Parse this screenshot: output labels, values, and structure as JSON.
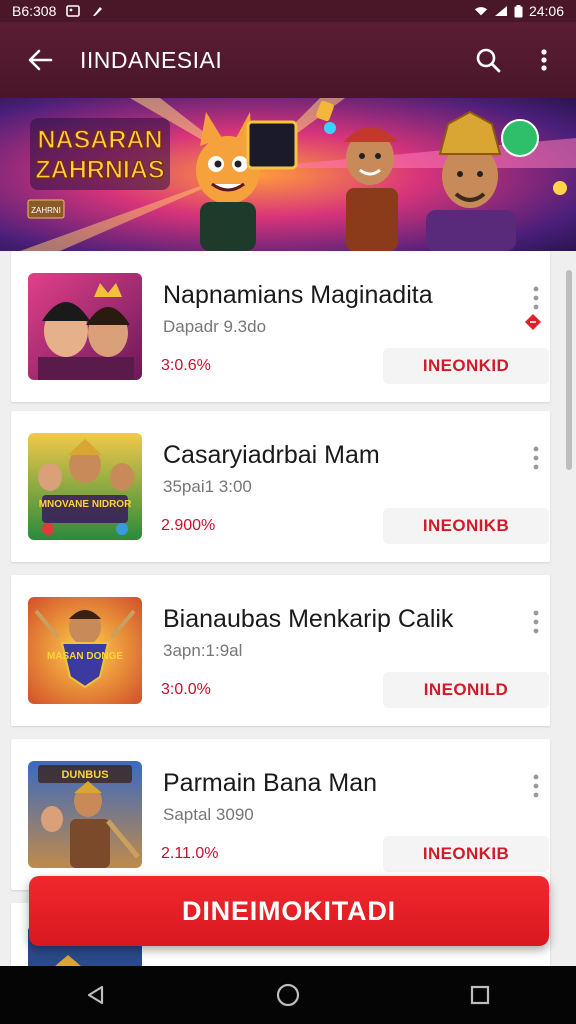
{
  "status_bar": {
    "left_text": "B6:308",
    "time": "24:06"
  },
  "app_bar": {
    "title": "IINDANESIAI"
  },
  "banner": {
    "title_line1": "NASARAN",
    "title_line2": "ZAHRNIAS",
    "small_label": "ZAHRNI"
  },
  "games": [
    {
      "name": "Napnamians Maginadita",
      "subtitle": "Dapadr 9.3do",
      "percent": "3:0.6%",
      "button": "INEONKID",
      "thumb_label": ""
    },
    {
      "name": "Casaryiadrbai Mam",
      "subtitle": "35pai1 3:00",
      "percent": "2.900%",
      "button": "INEONIKB",
      "thumb_label": "MNOVANE NIDROR"
    },
    {
      "name": "Bianaubas Menkarip Calik",
      "subtitle": "3apn:1:9al",
      "percent": "3:0.0%",
      "button": "INEONILD",
      "thumb_label": "MASAN DONGE"
    },
    {
      "name": "Parmain Bana Man",
      "subtitle": "Saptal 3090",
      "percent": "2.11.0%",
      "button": "INEONKIB",
      "thumb_label": "DUNBUS"
    }
  ],
  "fab": {
    "label": "DINEIMOKITADI"
  },
  "colors": {
    "app_bar": "#5b1d33",
    "accent_red": "#d91820",
    "button_text": "#d11a2a"
  },
  "icons": {
    "back": "arrow-left",
    "search": "search",
    "more": "more-vert",
    "nav_back": "triangle-left",
    "nav_home": "circle",
    "nav_recent": "square"
  }
}
